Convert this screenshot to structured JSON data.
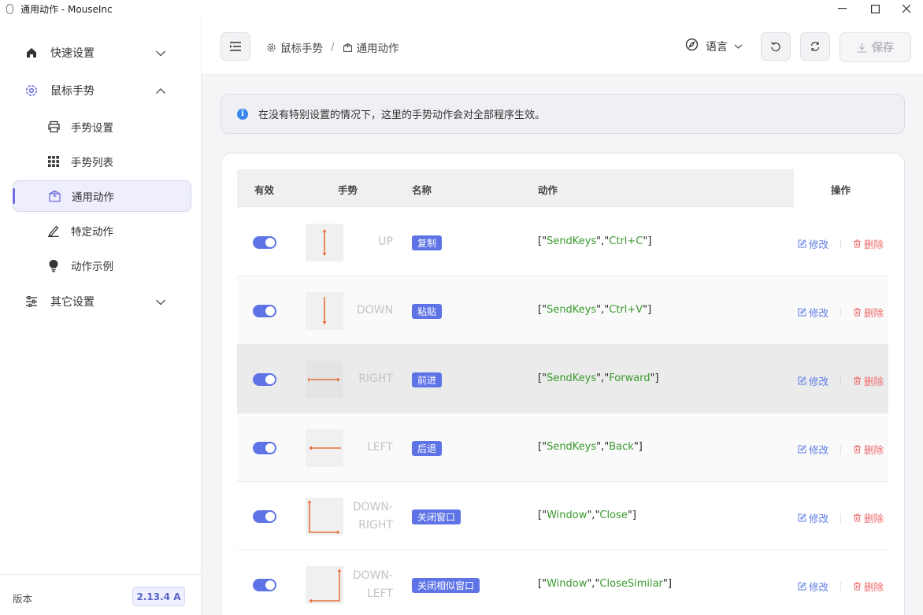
{
  "window": {
    "title": "通用动作 - MouseInc"
  },
  "sidebar": {
    "items": [
      {
        "label": "快速设置",
        "icon": "home-icon"
      },
      {
        "label": "鼠标手势",
        "icon": "gear-icon"
      },
      {
        "label": "手势设置",
        "icon": "printer-icon"
      },
      {
        "label": "手势列表",
        "icon": "grid-icon"
      },
      {
        "label": "通用动作",
        "icon": "box-icon"
      },
      {
        "label": "特定动作",
        "icon": "pen-icon"
      },
      {
        "label": "动作示例",
        "icon": "bulb-icon"
      },
      {
        "label": "其它设置",
        "icon": "sliders-icon"
      }
    ],
    "footer": {
      "version_label": "版本",
      "version": "2.13.4 A"
    }
  },
  "header": {
    "breadcrumb": [
      "鼠标手势",
      "通用动作"
    ],
    "breadcrumb_sep": "/",
    "language_label": "语言",
    "save_label": "保存"
  },
  "banner": {
    "text": "在没有特别设置的情况下，这里的手势动作会对全部程序生效。"
  },
  "table": {
    "headers": {
      "enabled": "有效",
      "gesture": "手势",
      "name": "名称",
      "action": "动作",
      "ops": "操作"
    },
    "edit_label": "修改",
    "delete_label": "删除",
    "rows": [
      {
        "enabled": true,
        "gesture": "UP",
        "name": "复制",
        "action_pre": "[\"",
        "action_a": "SendKeys",
        "action_mid": "\",\"",
        "action_b": "Ctrl+C",
        "action_post": "\"]"
      },
      {
        "enabled": true,
        "gesture": "DOWN",
        "name": "粘贴",
        "action_pre": "[\"",
        "action_a": "SendKeys",
        "action_mid": "\",\"",
        "action_b": "Ctrl+V",
        "action_post": "\"]"
      },
      {
        "enabled": true,
        "gesture": "RIGHT",
        "name": "前进",
        "action_pre": "[\"",
        "action_a": "SendKeys",
        "action_mid": "\",\"",
        "action_b": "Forward",
        "action_post": "\"]"
      },
      {
        "enabled": true,
        "gesture": "LEFT",
        "name": "后退",
        "action_pre": "[\"",
        "action_a": "SendKeys",
        "action_mid": "\",\"",
        "action_b": "Back",
        "action_post": "\"]"
      },
      {
        "enabled": true,
        "gesture_1": "DOWN-",
        "gesture_2": "RIGHT",
        "name": "关闭窗口",
        "action_pre": "[\"",
        "action_a": "Window",
        "action_mid": "\",\"",
        "action_b": "Close",
        "action_post": "\"]"
      },
      {
        "enabled": true,
        "gesture_1": "DOWN-",
        "gesture_2": "LEFT",
        "name": "关闭相似窗口",
        "action_pre": "[\"",
        "action_a": "Window",
        "action_mid": "\",\"",
        "action_b": "CloseSimilar",
        "action_post": "\"]"
      }
    ]
  },
  "colors": {
    "accent": "#5d73e6",
    "gesture_line": "#e8703a",
    "string_green": "#3a9a2e",
    "delete_red": "#ee6b6b"
  }
}
